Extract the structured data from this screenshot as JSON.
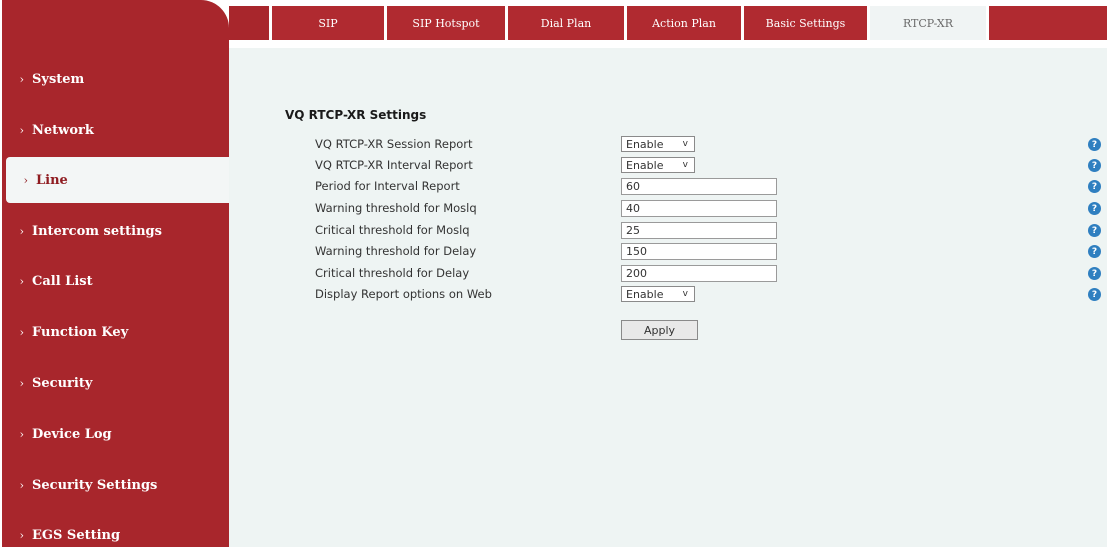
{
  "sidebar": {
    "items": [
      {
        "label": "System"
      },
      {
        "label": "Network"
      },
      {
        "label": "Line"
      },
      {
        "label": "Intercom settings"
      },
      {
        "label": "Call List"
      },
      {
        "label": "Function Key"
      },
      {
        "label": "Security"
      },
      {
        "label": "Device Log"
      },
      {
        "label": "Security Settings"
      },
      {
        "label": "EGS Setting"
      }
    ],
    "active": "Line",
    "chevron": "›"
  },
  "tabs": [
    {
      "label": "SIP"
    },
    {
      "label": "SIP Hotspot"
    },
    {
      "label": "Dial Plan"
    },
    {
      "label": "Action Plan"
    },
    {
      "label": "Basic Settings"
    },
    {
      "label": "RTCP-XR"
    }
  ],
  "active_tab": "RTCP-XR",
  "section": {
    "title": "VQ RTCP-XR Settings"
  },
  "fields": [
    {
      "label": "VQ RTCP-XR Session Report",
      "type": "select",
      "value": "Enable"
    },
    {
      "label": "VQ RTCP-XR Interval Report",
      "type": "select",
      "value": "Enable"
    },
    {
      "label": "Period for Interval Report",
      "type": "text",
      "value": "60"
    },
    {
      "label": "Warning threshold for Moslq",
      "type": "text",
      "value": "40"
    },
    {
      "label": "Critical threshold for Moslq",
      "type": "text",
      "value": "25"
    },
    {
      "label": "Warning threshold for Delay",
      "type": "text",
      "value": "150"
    },
    {
      "label": "Critical threshold for Delay",
      "type": "text",
      "value": "200"
    },
    {
      "label": "Display Report options on Web",
      "type": "select",
      "value": "Enable"
    }
  ],
  "apply_label": "Apply",
  "help_glyph": "?",
  "select_arrow": "v",
  "colors": {
    "brand_red": "#a8262c",
    "content_bg": "#eef4f3",
    "help_blue": "#2f7fc0"
  }
}
